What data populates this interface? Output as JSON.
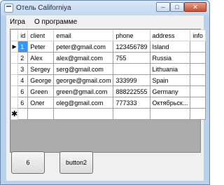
{
  "window": {
    "title": "Отель Californiya",
    "min_glyph": "–",
    "max_glyph": "□",
    "close_glyph": "✕"
  },
  "menu": {
    "items": [
      {
        "label": "Игра"
      },
      {
        "label": "О программе"
      }
    ]
  },
  "grid": {
    "columns": [
      "id",
      "client",
      "email",
      "phone",
      "address",
      "info"
    ],
    "current_row_marker": "▶",
    "new_row_marker": "✱",
    "rows": [
      {
        "id": "1",
        "client": "Peter",
        "email": "peter@gmail.com",
        "phone": "123456789",
        "address": "Island",
        "info": ""
      },
      {
        "id": "2",
        "client": "Alex",
        "email": "alex@gmail.com",
        "phone": "755",
        "address": "Russia",
        "info": ""
      },
      {
        "id": "3",
        "client": "Sergey",
        "email": "serg@gmail.com",
        "phone": "",
        "address": "Lithuania",
        "info": ""
      },
      {
        "id": "4",
        "client": "George",
        "email": "george@gmail.com",
        "phone": "333999",
        "address": "Spain",
        "info": ""
      },
      {
        "id": "6",
        "client": "Green",
        "email": "green@gmail.com",
        "phone": "888222555",
        "address": "Germany",
        "info": ""
      },
      {
        "id": "6",
        "client": "Олег",
        "email": "oleg@gmail.com",
        "phone": "777333",
        "address": "Октябрьск...",
        "info": ""
      }
    ]
  },
  "buttons": {
    "button1": "6",
    "button2": "button2"
  },
  "colors": {
    "selection": "#3399ff",
    "window_frame": "#b9d1ea"
  }
}
